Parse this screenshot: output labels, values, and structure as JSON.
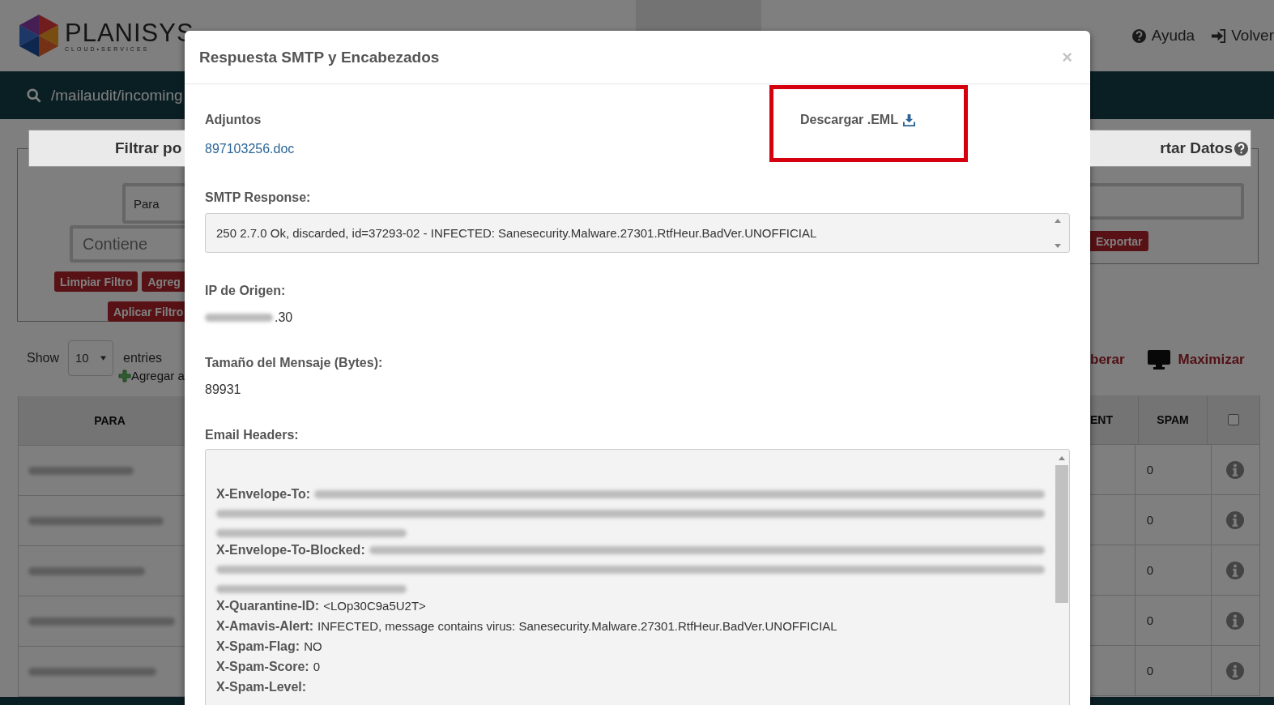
{
  "header": {
    "logo": {
      "name": "PLANISYS",
      "tagline": "CLOUD•SERVICES"
    },
    "nav": [
      {
        "label": "Ayuda",
        "kind": "help"
      },
      {
        "label": "Volver",
        "kind": "exit"
      }
    ]
  },
  "search_bar": {
    "path": "/mailaudit/incoming"
  },
  "filter_panel": {
    "title": "Filtrar po",
    "field": "Para",
    "placeholder": "Contiene",
    "buttons": [
      "Limpiar Filtro",
      "Agreg",
      "Aplicar Filtro"
    ]
  },
  "export_panel": {
    "title": "rtar Datos",
    "button": "Exportar"
  },
  "table_controls": {
    "show": "Show",
    "page_size": "10",
    "entries": "entries",
    "add_label": "Agregar a",
    "release_label": "berar",
    "maximize_label": "Maximizar"
  },
  "table": {
    "columns_left": [
      "PARA"
    ],
    "columns_right": [
      "ENT",
      "SPAM"
    ],
    "select_all": {
      "checked": false
    },
    "rows": [
      {
        "spam": "0"
      },
      {
        "spam": "0"
      },
      {
        "spam": "0"
      },
      {
        "spam": "0"
      },
      {
        "spam": "0"
      }
    ]
  },
  "modal": {
    "title": "Respuesta SMTP y Encabezados",
    "close": "×",
    "attachments_label": "Adjuntos",
    "attachment": "897103256.doc",
    "download": {
      "label": "Descargar .EML",
      "highlighted": true
    },
    "smtp_label": "SMTP Response:",
    "smtp_response": "250 2.7.0 Ok, discarded, id=37293-02 - INFECTED: Sanesecurity.Malware.27301.RtfHeur.BadVer.UNOFFICIAL",
    "ip_label": "IP de Origen:",
    "ip_suffix": ".30",
    "size_label": "Tamaño del Mensaje (Bytes):",
    "size": "89931",
    "headers_label": "Email Headers:",
    "headers": [
      {
        "key": "X-Envelope-To:",
        "kind": "redacted"
      },
      {
        "key": "X-Envelope-To-Blocked:",
        "kind": "redacted"
      },
      {
        "key": "X-Quarantine-ID:",
        "kind": "text",
        "value": "<LOp30C9a5U2T>"
      },
      {
        "key": "X-Amavis-Alert:",
        "kind": "text",
        "value": "INFECTED, message contains virus: Sanesecurity.Malware.27301.RtfHeur.BadVer.UNOFFICIAL"
      },
      {
        "key": "X-Spam-Flag:",
        "kind": "text",
        "value": "NO"
      },
      {
        "key": "X-Spam-Score:",
        "kind": "text",
        "value": "0"
      },
      {
        "key": "X-Spam-Level:",
        "kind": "text"
      }
    ]
  }
}
